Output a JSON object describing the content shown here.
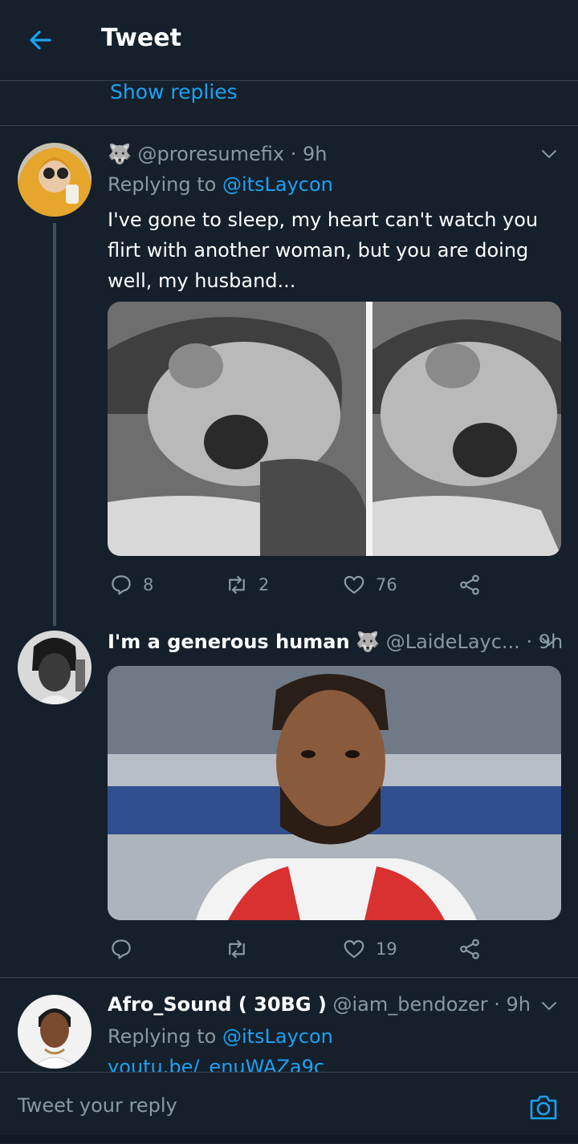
{
  "header": {
    "title": "Tweet"
  },
  "thread": {
    "show_replies_label": "Show replies"
  },
  "tweets": [
    {
      "emoji": "🐺",
      "handle": "@proresumefix",
      "time_sep": " · ",
      "time": "9h",
      "replying_label": "Replying to ",
      "replying_to": "@itsLaycon",
      "text": "I've gone to sleep, my heart can't watch you flirt with another woman, but you are doing well, my husband...",
      "replies": "8",
      "retweets": "2",
      "likes": "76"
    },
    {
      "name": "I'm a generous human",
      "emoji": "🐺",
      "handle": "@LaideLayc...",
      "time_sep": " · ",
      "time": "9h",
      "replies": "",
      "retweets": "",
      "likes": "19"
    },
    {
      "name": "Afro_Sound ( 30BG )",
      "handle": "@iam_bendozer",
      "time_sep": " · ",
      "time": "9h",
      "replying_label": "Replying to ",
      "replying_to": "@itsLaycon",
      "partial_text": "youtu.be/_enuWAZa9c"
    }
  ],
  "composer": {
    "placeholder": "Tweet your reply"
  },
  "colors": {
    "background": "#15202b",
    "accent": "#1da1f2",
    "muted": "#8899a6",
    "divider": "#38444d"
  }
}
